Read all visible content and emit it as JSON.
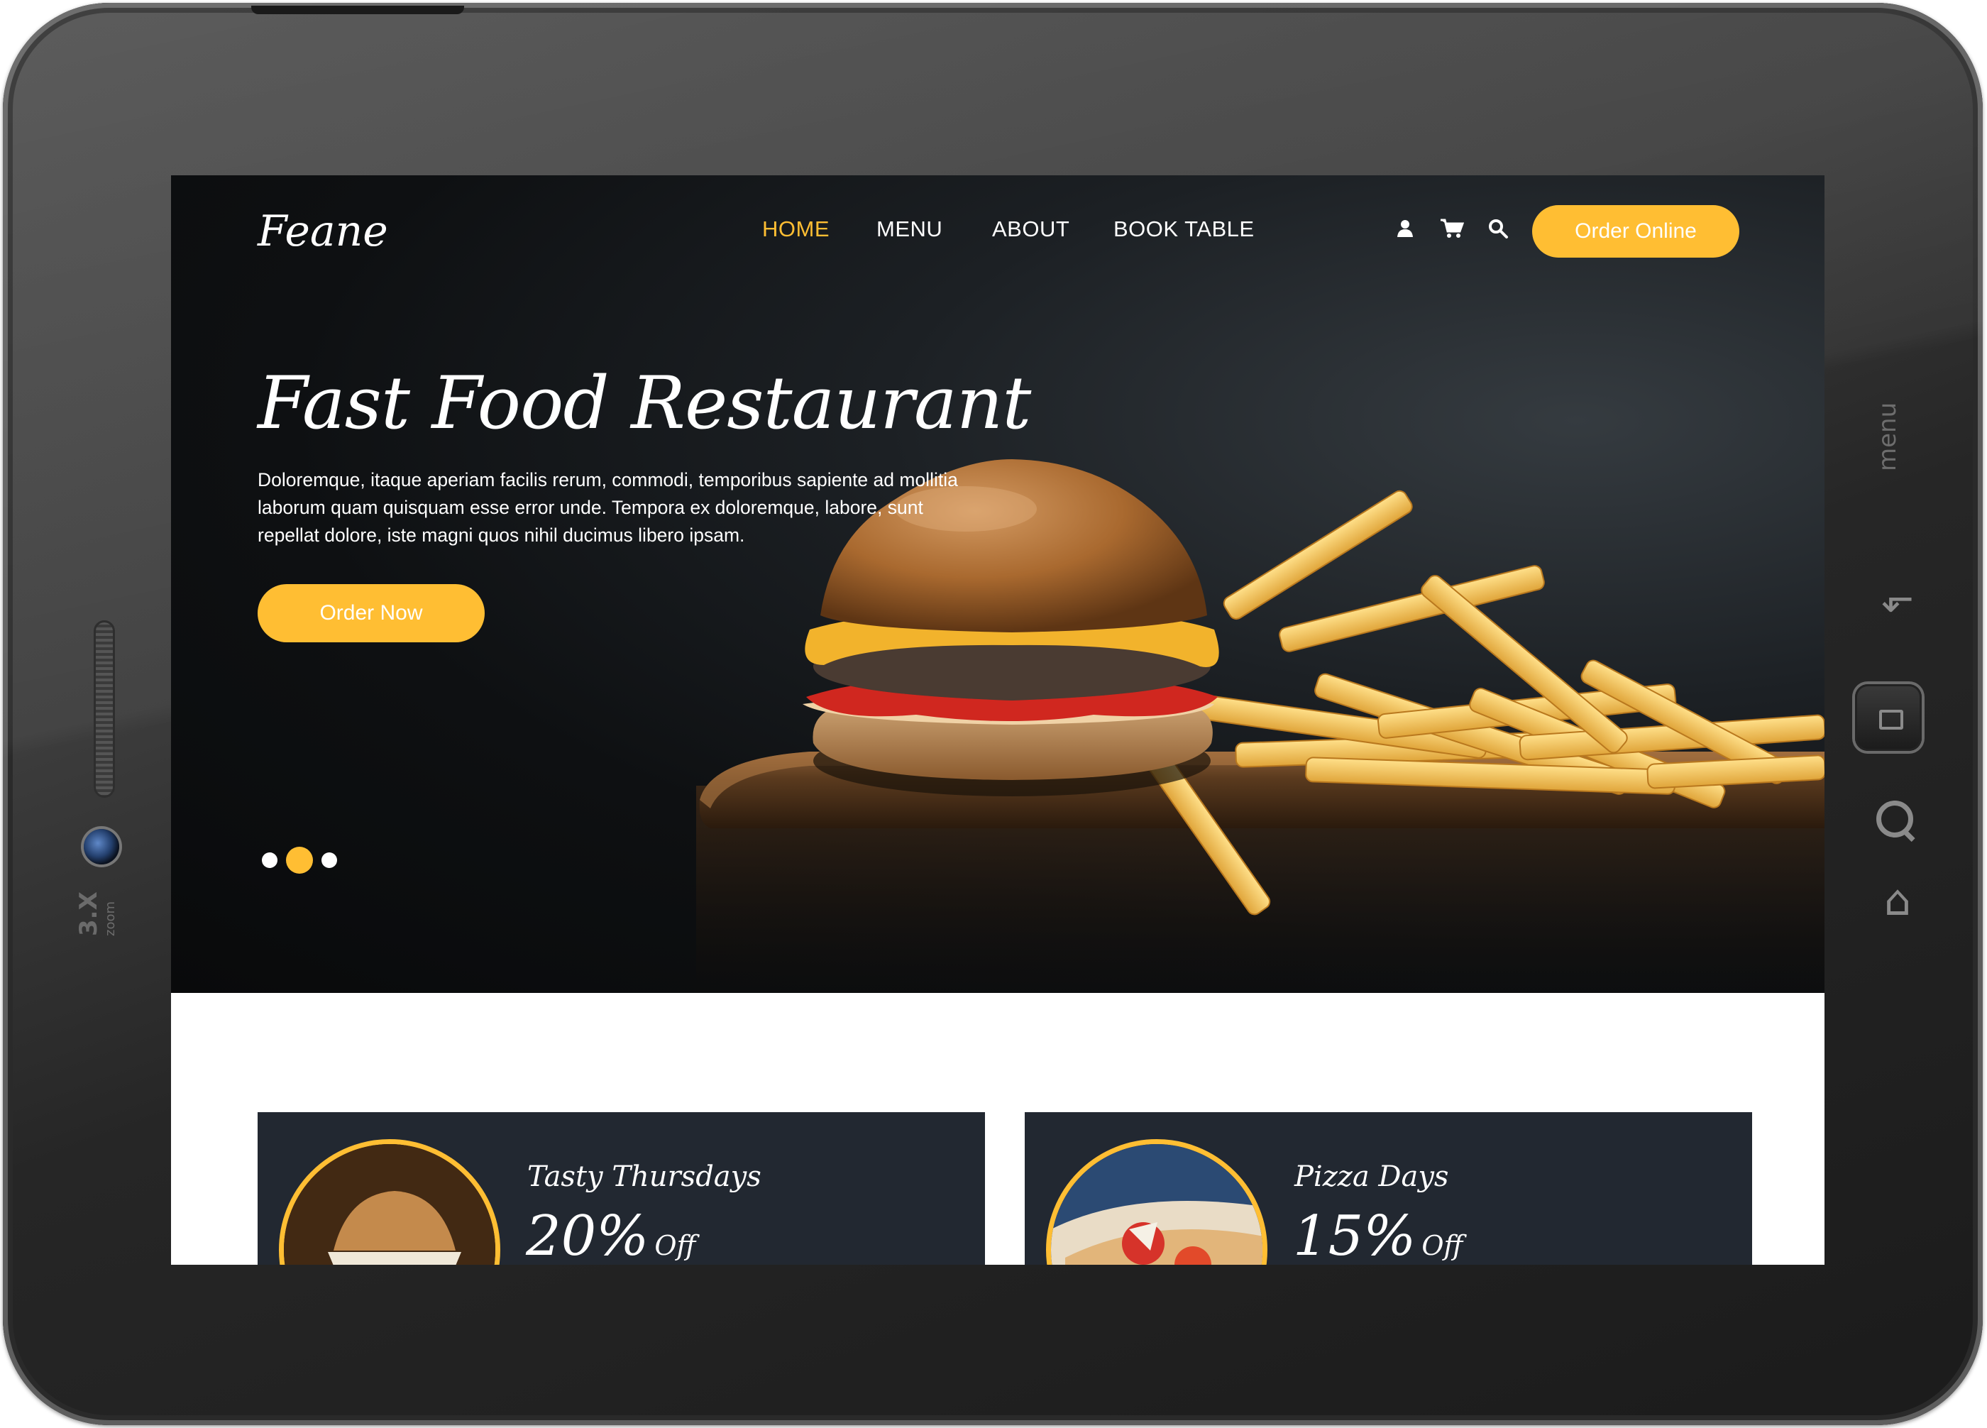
{
  "device": {
    "zoom_label_big": "3.X",
    "zoom_label_small": "zoom",
    "side_menu_label": "menu"
  },
  "header": {
    "logo": "Feane",
    "nav": [
      {
        "label": "HOME",
        "active": true
      },
      {
        "label": "MENU",
        "active": false
      },
      {
        "label": "ABOUT",
        "active": false
      },
      {
        "label": "BOOK TABLE",
        "active": false
      }
    ],
    "icons": [
      "user-icon",
      "cart-icon",
      "search-icon"
    ],
    "cta": "Order Online"
  },
  "hero": {
    "title": "Fast Food Restaurant",
    "description": "Doloremque, itaque aperiam facilis rerum, commodi, temporibus sapiente ad mollitia laborum quam quisquam esse error unde. Tempora ex doloremque, labore, sunt repellat dolore, iste magni quos nihil ducimus libero ipsam.",
    "cta": "Order Now",
    "slides": 3,
    "active_slide": 2
  },
  "offers": [
    {
      "title": "Tasty Thursdays",
      "percent": "20%",
      "suffix": "Off"
    },
    {
      "title": "Pizza Days",
      "percent": "15%",
      "suffix": "Off"
    }
  ],
  "colors": {
    "accent": "#ffbe33",
    "hero_bg": "#0e1012",
    "card_bg": "#222831",
    "device_frame": "#333333"
  }
}
